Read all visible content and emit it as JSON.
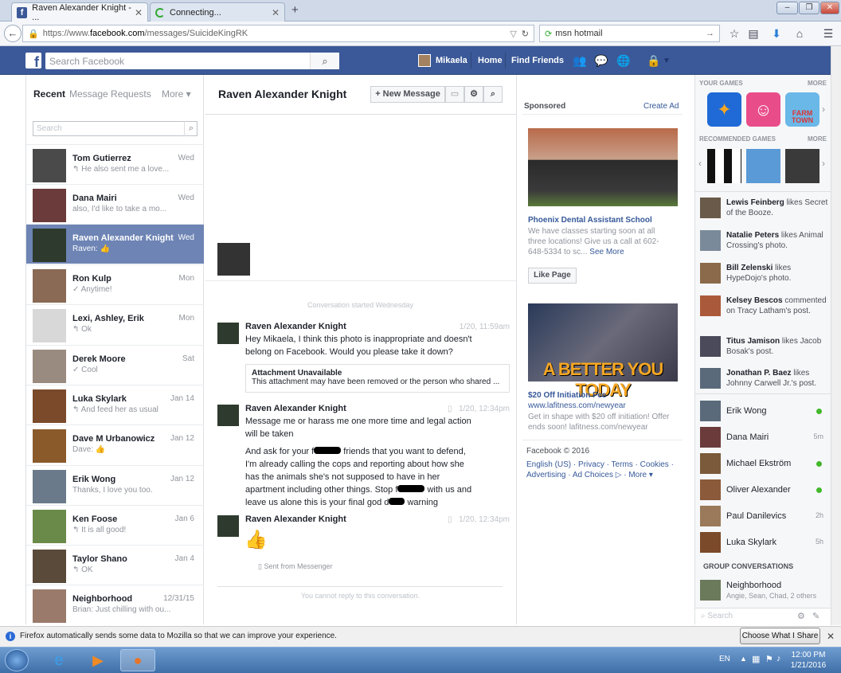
{
  "browser": {
    "tabs": [
      {
        "label": "Raven Alexander Knight - ..."
      },
      {
        "label": "Connecting..."
      }
    ],
    "new_tab": "+",
    "url_prefix": "https://www.",
    "url_domain": "facebook.com",
    "url_path": "/messages/SuicideKingRK",
    "search_value": "msn hotmail"
  },
  "fb": {
    "logo": "f",
    "search_placeholder": "Search Facebook",
    "user_name": "Mikaela",
    "home": "Home",
    "find_friends": "Find Friends"
  },
  "left": {
    "tab_recent": "Recent",
    "tab_requests": "Message Requests",
    "tab_more": "More ▾",
    "search_placeholder": "Search",
    "conversations": [
      {
        "name": "Tom Gutierrez",
        "snippet": "↰ He also sent me a love...",
        "date": "Wed"
      },
      {
        "name": "Dana Mairi",
        "snippet": "also, I'd like to take a mo...",
        "date": "Wed"
      },
      {
        "name": "Raven Alexander Knight",
        "snippet": "Raven: 👍",
        "date": "Wed"
      },
      {
        "name": "Ron Kulp",
        "snippet": "✓ Anytime!",
        "date": "Mon"
      },
      {
        "name": "Lexi, Ashley, Erik",
        "snippet": "↰ Ok",
        "date": "Mon"
      },
      {
        "name": "Derek Moore",
        "snippet": "✓ Cool",
        "date": "Sat"
      },
      {
        "name": "Luka Skylark",
        "snippet": "↰ And feed her as usual",
        "date": "Jan 14"
      },
      {
        "name": "Dave M Urbanowicz",
        "snippet": "Dave: 👍",
        "date": "Jan 12"
      },
      {
        "name": "Erik Wong",
        "snippet": "Thanks, I love you too.",
        "date": "Jan 12"
      },
      {
        "name": "Ken Foose",
        "snippet": "↰ It is all good!",
        "date": "Jan 6"
      },
      {
        "name": "Taylor Shano",
        "snippet": "↰ OK",
        "date": "Jan 4"
      },
      {
        "name": "Neighborhood",
        "snippet": "Brian: Just chilling with ou...",
        "date": "12/31/15"
      }
    ]
  },
  "conversation": {
    "title": "Raven Alexander Knight",
    "new_message": "+ New Message",
    "started": "Conversation started Wednesday",
    "messages": [
      {
        "sender": "Raven Alexander Knight",
        "time": "1/20, 11:59am",
        "text": "Hey Mikaela, I think this photo is inappropriate and doesn't belong on Facebook. Would you please take it down?"
      },
      {
        "sender": "Raven Alexander Knight",
        "time": "1/20, 12:34pm",
        "text": "Message me or harass me one more time and legal action will be taken"
      },
      {
        "sender": "Raven Alexander Knight",
        "time": "1/20, 12:34pm",
        "text": "👍"
      }
    ],
    "attachment_title": "Attachment Unavailable",
    "attachment_text": "This attachment may have been removed or the person who shared ...",
    "message2_part2": "And ask for your f",
    "message2_part2b": " friends that you want to defend, I'm already calling the cops and reporting about how she has the animals she's not supposed to have in her apartment including other things. Stop f",
    "message2_part2c": " with us and leave us alone this is your final god d",
    "message2_part2d": " warning",
    "sent_from": "Sent from Messenger",
    "cannot_reply": "You cannot reply to this conversation."
  },
  "ads": {
    "sponsored": "Sponsored",
    "create_ad": "Create Ad",
    "ad1_title": "Phoenix Dental Assistant School",
    "ad1_text": "We have classes starting soon at all three locations! Give us a call at 602-648-5334 to sc...",
    "ad1_see_more": "See More",
    "ad1_like": "Like Page",
    "ad2_banner": "A BETTER YOU TODAY",
    "ad2_title": "$20 Off Initiation Fee",
    "ad2_url": "www.lafitness.com/newyear",
    "ad2_text": "Get in shape with $20 off initiation! Offer ends soon! lafitness.com/newyear",
    "footer_copy": "Facebook © 2016",
    "footer_links": [
      "English (US)",
      "Privacy",
      "Terms",
      "Cookies",
      "Advertising",
      "Ad Choices",
      "More ▾"
    ]
  },
  "sidebar": {
    "your_games": "YOUR GAMES",
    "more": "MORE",
    "recommended_games": "RECOMMENDED GAMES",
    "farm_town": "FARM TOWN",
    "ticker": [
      {
        "name": "Lewis Feinberg",
        "rest": " likes Secret of the Booze."
      },
      {
        "name": "Natalie Peters",
        "rest": " likes Animal Crossing's photo."
      },
      {
        "name": "Bill Zelenski",
        "rest": " likes HypeDojo's photo."
      },
      {
        "name": "Kelsey Bescos",
        "rest": " commented on Tracy Latham's post."
      },
      {
        "name": "Titus Jamison",
        "rest": " likes Jacob Bosak's post."
      },
      {
        "name": "Jonathan P. Baez",
        "rest": " likes Johnny Carwell Jr.'s post."
      }
    ],
    "chat": [
      {
        "name": "Erik Wong",
        "status": ""
      },
      {
        "name": "Dana Mairi",
        "status": "5m"
      },
      {
        "name": "Michael Ekström",
        "status": ""
      },
      {
        "name": "Oliver Alexander",
        "status": ""
      },
      {
        "name": "Paul Danilevics",
        "status": "2h"
      },
      {
        "name": "Luka Skylark",
        "status": "5h"
      }
    ],
    "group_header": "GROUP CONVERSATIONS",
    "group_name": "Neighborhood",
    "group_members": "Angie, Sean, Chad, 2 others",
    "search_placeholder": "Search"
  },
  "notification": {
    "text": "Firefox automatically sends some data to Mozilla so that we can improve your experience.",
    "button": "Choose What I Share"
  },
  "taskbar": {
    "lang": "EN",
    "time": "12:00 PM",
    "date": "1/21/2016"
  }
}
